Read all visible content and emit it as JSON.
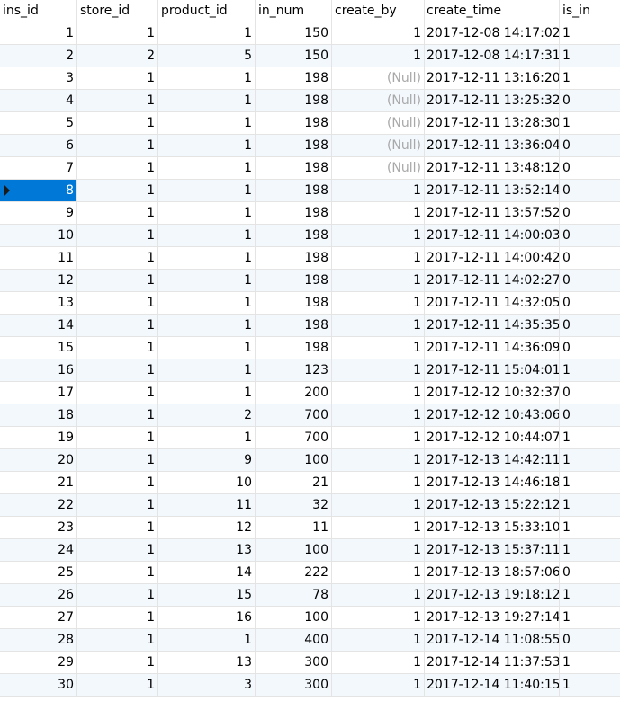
{
  "columns": [
    "ins_id",
    "store_id",
    "product_id",
    "in_num",
    "create_by",
    "create_time",
    "is_in"
  ],
  "null_text": "(Null)",
  "selected_row_index": 7,
  "rows": [
    {
      "ins_id": "1",
      "store_id": "1",
      "product_id": "1",
      "in_num": "150",
      "create_by": "1",
      "create_time": "2017-12-08 14:17:02",
      "is_in": "1"
    },
    {
      "ins_id": "2",
      "store_id": "2",
      "product_id": "5",
      "in_num": "150",
      "create_by": "1",
      "create_time": "2017-12-08 14:17:31",
      "is_in": "1"
    },
    {
      "ins_id": "3",
      "store_id": "1",
      "product_id": "1",
      "in_num": "198",
      "create_by": null,
      "create_time": "2017-12-11 13:16:20",
      "is_in": "1"
    },
    {
      "ins_id": "4",
      "store_id": "1",
      "product_id": "1",
      "in_num": "198",
      "create_by": null,
      "create_time": "2017-12-11 13:25:32",
      "is_in": "0"
    },
    {
      "ins_id": "5",
      "store_id": "1",
      "product_id": "1",
      "in_num": "198",
      "create_by": null,
      "create_time": "2017-12-11 13:28:30",
      "is_in": "1"
    },
    {
      "ins_id": "6",
      "store_id": "1",
      "product_id": "1",
      "in_num": "198",
      "create_by": null,
      "create_time": "2017-12-11 13:36:04",
      "is_in": "0"
    },
    {
      "ins_id": "7",
      "store_id": "1",
      "product_id": "1",
      "in_num": "198",
      "create_by": null,
      "create_time": "2017-12-11 13:48:12",
      "is_in": "0"
    },
    {
      "ins_id": "8",
      "store_id": "1",
      "product_id": "1",
      "in_num": "198",
      "create_by": "1",
      "create_time": "2017-12-11 13:52:14",
      "is_in": "0"
    },
    {
      "ins_id": "9",
      "store_id": "1",
      "product_id": "1",
      "in_num": "198",
      "create_by": "1",
      "create_time": "2017-12-11 13:57:52",
      "is_in": "0"
    },
    {
      "ins_id": "10",
      "store_id": "1",
      "product_id": "1",
      "in_num": "198",
      "create_by": "1",
      "create_time": "2017-12-11 14:00:03",
      "is_in": "0"
    },
    {
      "ins_id": "11",
      "store_id": "1",
      "product_id": "1",
      "in_num": "198",
      "create_by": "1",
      "create_time": "2017-12-11 14:00:42",
      "is_in": "0"
    },
    {
      "ins_id": "12",
      "store_id": "1",
      "product_id": "1",
      "in_num": "198",
      "create_by": "1",
      "create_time": "2017-12-11 14:02:27",
      "is_in": "0"
    },
    {
      "ins_id": "13",
      "store_id": "1",
      "product_id": "1",
      "in_num": "198",
      "create_by": "1",
      "create_time": "2017-12-11 14:32:05",
      "is_in": "0"
    },
    {
      "ins_id": "14",
      "store_id": "1",
      "product_id": "1",
      "in_num": "198",
      "create_by": "1",
      "create_time": "2017-12-11 14:35:35",
      "is_in": "0"
    },
    {
      "ins_id": "15",
      "store_id": "1",
      "product_id": "1",
      "in_num": "198",
      "create_by": "1",
      "create_time": "2017-12-11 14:36:09",
      "is_in": "0"
    },
    {
      "ins_id": "16",
      "store_id": "1",
      "product_id": "1",
      "in_num": "123",
      "create_by": "1",
      "create_time": "2017-12-11 15:04:01",
      "is_in": "1"
    },
    {
      "ins_id": "17",
      "store_id": "1",
      "product_id": "1",
      "in_num": "200",
      "create_by": "1",
      "create_time": "2017-12-12 10:32:37",
      "is_in": "0"
    },
    {
      "ins_id": "18",
      "store_id": "1",
      "product_id": "2",
      "in_num": "700",
      "create_by": "1",
      "create_time": "2017-12-12 10:43:06",
      "is_in": "0"
    },
    {
      "ins_id": "19",
      "store_id": "1",
      "product_id": "1",
      "in_num": "700",
      "create_by": "1",
      "create_time": "2017-12-12 10:44:07",
      "is_in": "1"
    },
    {
      "ins_id": "20",
      "store_id": "1",
      "product_id": "9",
      "in_num": "100",
      "create_by": "1",
      "create_time": "2017-12-13 14:42:11",
      "is_in": "1"
    },
    {
      "ins_id": "21",
      "store_id": "1",
      "product_id": "10",
      "in_num": "21",
      "create_by": "1",
      "create_time": "2017-12-13 14:46:18",
      "is_in": "1"
    },
    {
      "ins_id": "22",
      "store_id": "1",
      "product_id": "11",
      "in_num": "32",
      "create_by": "1",
      "create_time": "2017-12-13 15:22:12",
      "is_in": "1"
    },
    {
      "ins_id": "23",
      "store_id": "1",
      "product_id": "12",
      "in_num": "11",
      "create_by": "1",
      "create_time": "2017-12-13 15:33:10",
      "is_in": "1"
    },
    {
      "ins_id": "24",
      "store_id": "1",
      "product_id": "13",
      "in_num": "100",
      "create_by": "1",
      "create_time": "2017-12-13 15:37:11",
      "is_in": "1"
    },
    {
      "ins_id": "25",
      "store_id": "1",
      "product_id": "14",
      "in_num": "222",
      "create_by": "1",
      "create_time": "2017-12-13 18:57:06",
      "is_in": "0"
    },
    {
      "ins_id": "26",
      "store_id": "1",
      "product_id": "15",
      "in_num": "78",
      "create_by": "1",
      "create_time": "2017-12-13 19:18:12",
      "is_in": "1"
    },
    {
      "ins_id": "27",
      "store_id": "1",
      "product_id": "16",
      "in_num": "100",
      "create_by": "1",
      "create_time": "2017-12-13 19:27:14",
      "is_in": "1"
    },
    {
      "ins_id": "28",
      "store_id": "1",
      "product_id": "1",
      "in_num": "400",
      "create_by": "1",
      "create_time": "2017-12-14 11:08:55",
      "is_in": "0"
    },
    {
      "ins_id": "29",
      "store_id": "1",
      "product_id": "13",
      "in_num": "300",
      "create_by": "1",
      "create_time": "2017-12-14 11:37:53",
      "is_in": "1"
    },
    {
      "ins_id": "30",
      "store_id": "1",
      "product_id": "3",
      "in_num": "300",
      "create_by": "1",
      "create_time": "2017-12-14 11:40:15",
      "is_in": "1"
    }
  ]
}
